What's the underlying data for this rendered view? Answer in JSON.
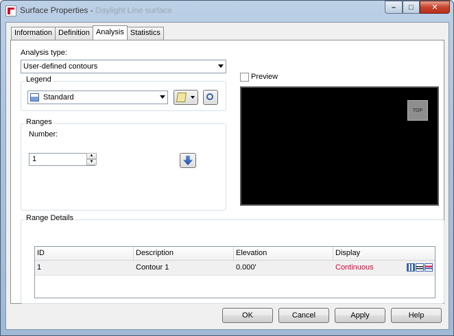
{
  "window": {
    "title_prefix": "Surface Properties - ",
    "title_surface": "Daylight Line surface",
    "min_glyph": "–",
    "max_glyph": "□",
    "close_glyph": "✕"
  },
  "tabs": [
    {
      "label": "Information",
      "active": false
    },
    {
      "label": "Definition",
      "active": false
    },
    {
      "label": "Analysis",
      "active": true
    },
    {
      "label": "Statistics",
      "active": false
    }
  ],
  "analysis": {
    "type_label": "Analysis type:",
    "type_value": "User-defined contours"
  },
  "legend": {
    "group_label": "Legend",
    "value": "Standard"
  },
  "ranges": {
    "group_label": "Ranges",
    "number_label": "Number:",
    "number_value": "1"
  },
  "preview": {
    "label": "Preview",
    "checked": false,
    "viewcube_label": "TOP"
  },
  "range_details": {
    "group_label": "Range Details",
    "columns": [
      "ID",
      "Description",
      "Elevation",
      "Display"
    ],
    "rows": [
      {
        "id": "1",
        "description": "Contour 1",
        "elevation": "0.000'",
        "display": "Continuous"
      }
    ]
  },
  "buttons": {
    "ok": "OK",
    "cancel": "Cancel",
    "apply": "Apply",
    "help": "Help"
  },
  "colors": {
    "display_text": "#d6003a",
    "preview_bg": "#000000"
  }
}
